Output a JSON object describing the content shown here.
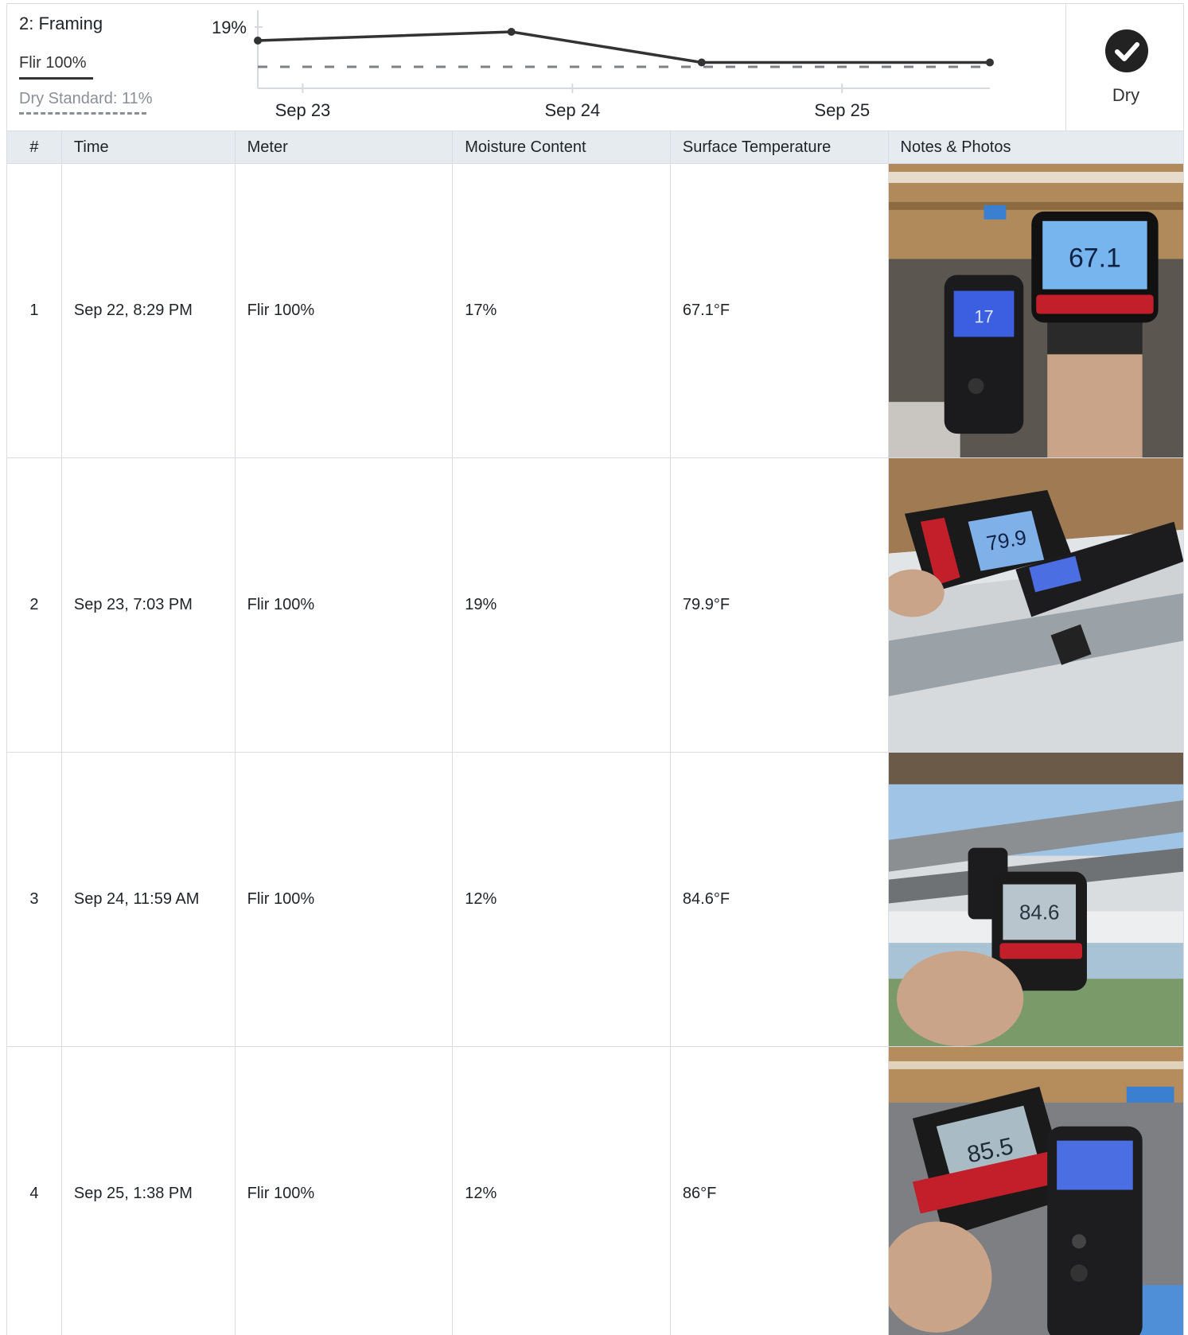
{
  "header": {
    "title": "2: Framing",
    "legend_meter": "Flir 100%",
    "legend_dry": "Dry Standard: 11%",
    "status_icon": "check-circle-icon",
    "status_label": "Dry"
  },
  "chart_data": {
    "type": "line",
    "y_tick_label": "19%",
    "x_tick_labels": [
      "Sep 23",
      "Sep 24",
      "Sep 25"
    ],
    "series": [
      {
        "name": "Flir 100%",
        "points": [
          {
            "x": "Sep 22, 8:29 PM",
            "y": 17
          },
          {
            "x": "Sep 23, 7:03 PM",
            "y": 19
          },
          {
            "x": "Sep 24, 11:59 AM",
            "y": 12
          },
          {
            "x": "Sep 25, 1:38 PM",
            "y": 12
          }
        ],
        "color": "#333333"
      }
    ],
    "dry_standard": 11
  },
  "table": {
    "columns": [
      "#",
      "Time",
      "Meter",
      "Moisture Content",
      "Surface Temperature",
      "Notes & Photos"
    ],
    "rows": [
      {
        "num": "1",
        "time": "Sep 22, 8:29 PM",
        "meter": "Flir 100%",
        "moisture": "17%",
        "temp": "67.1°F",
        "photo_reading": "67.1"
      },
      {
        "num": "2",
        "time": "Sep 23, 7:03 PM",
        "meter": "Flir 100%",
        "moisture": "19%",
        "temp": "79.9°F",
        "photo_reading": "79.9"
      },
      {
        "num": "3",
        "time": "Sep 24, 11:59 AM",
        "meter": "Flir 100%",
        "moisture": "12%",
        "temp": "84.6°F",
        "photo_reading": "84.6"
      },
      {
        "num": "4",
        "time": "Sep 25, 1:38 PM",
        "meter": "Flir 100%",
        "moisture": "12%",
        "temp": "86°F",
        "photo_reading": "85.5"
      }
    ]
  }
}
